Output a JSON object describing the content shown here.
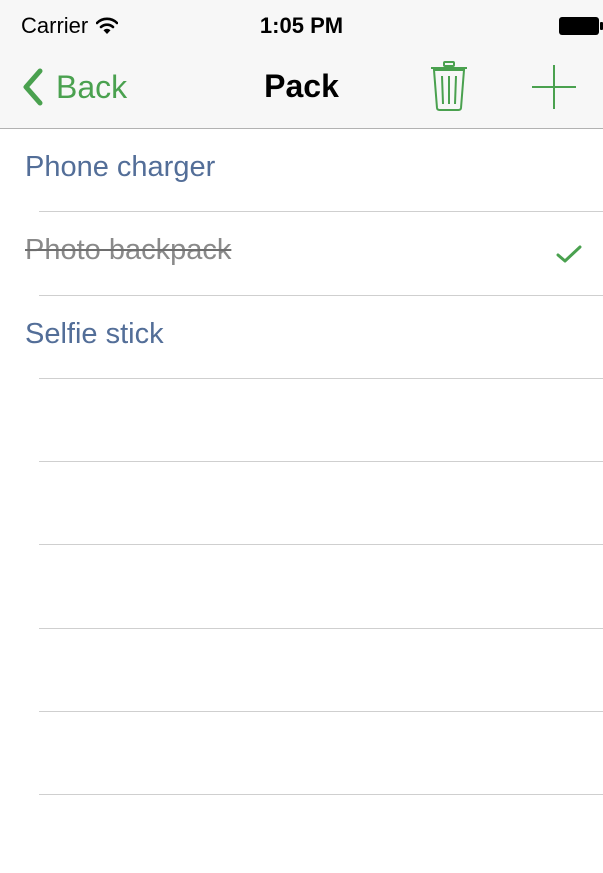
{
  "status_bar": {
    "carrier": "Carrier",
    "time": "1:05 PM",
    "wifi_icon": "wifi-icon",
    "battery_icon": "battery-icon"
  },
  "nav": {
    "back_label": "Back",
    "title": "Pack",
    "trash_icon": "trash-icon",
    "add_icon": "plus-icon",
    "accent_color": "#4aa14f"
  },
  "list": {
    "items": [
      {
        "label": "Phone charger",
        "checked": false
      },
      {
        "label": "Photo backpack",
        "checked": true
      },
      {
        "label": "Selfie stick",
        "checked": false
      },
      {
        "label": "",
        "checked": false
      },
      {
        "label": "",
        "checked": false
      },
      {
        "label": "",
        "checked": false
      },
      {
        "label": "",
        "checked": false
      },
      {
        "label": "",
        "checked": false
      }
    ],
    "item_color": "#536e98",
    "checked_color": "#8a8a8a"
  }
}
